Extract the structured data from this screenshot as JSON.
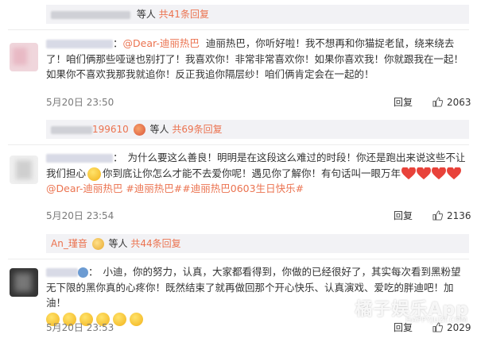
{
  "threads": [
    {
      "reply_summary": {
        "suffix": "等人",
        "count_link": "共41条回复"
      }
    },
    {
      "text": {
        "sep": "：",
        "mention": "@Dear-迪丽热巴",
        "body": "迪丽热巴，你听好啦！我不想再和你猫捉老鼠，绕来绕去了！咱们俩那些哑谜也别打了！我喜欢你！非常非常喜欢你！如果你喜欢我！你就跟我在一起！如果你不喜欢我那我就追你！反正我追你隔层纱！咱们俩肯定会在一起的！"
      },
      "meta": {
        "time": "5月20日 23:50",
        "reply": "回复",
        "likes": "2063"
      }
    },
    {
      "reply_summary": {
        "name_visible": "199610",
        "suffix": "等人",
        "count_link": "共69条回复"
      }
    },
    {
      "text": {
        "sep": "：",
        "body1": "为什么要这么善良！明明是在这段这么难过的时段！你还是跑出来说这些不让我们担心",
        "body2": "你到底让你怎么才能不去爱你呢！遇见你了解你！有句话叫一眼万年",
        "mention": "@Dear-迪丽热巴",
        "tag1": "#迪丽热巴#",
        "tag2": "#迪丽热巴0603生日快乐#"
      },
      "meta": {
        "time": "5月20日 23:54",
        "reply": "回复",
        "likes": "2136"
      }
    },
    {
      "reply_summary": {
        "name_visible": "An_瑾音",
        "suffix": "等人",
        "count_link": "共44条回复"
      }
    },
    {
      "text": {
        "sep": "：",
        "body": "小迪，你的努力，认真，大家都看得到，你做的已经很好了，其实每次看到黑粉望无下限的黑你真的心疼你！既然结束了就再做回那个开心快乐、认真演戏、爱吃的胖迪吧！加油！"
      },
      "meta": {
        "time": "5月20日 23:53",
        "reply": "回复",
        "likes": "2029"
      }
    }
  ],
  "watermark": {
    "main": "橘子娱乐App",
    "sub": "HAPPYJUZI.COM"
  },
  "colors": {
    "accent": "#eb7350",
    "reply_bg": "#f2f2f5",
    "heart": "#e8423a"
  },
  "icons": {
    "like": "thumbs-up-icon",
    "heart": "heart-icon",
    "face": "emoji-face-icon"
  }
}
